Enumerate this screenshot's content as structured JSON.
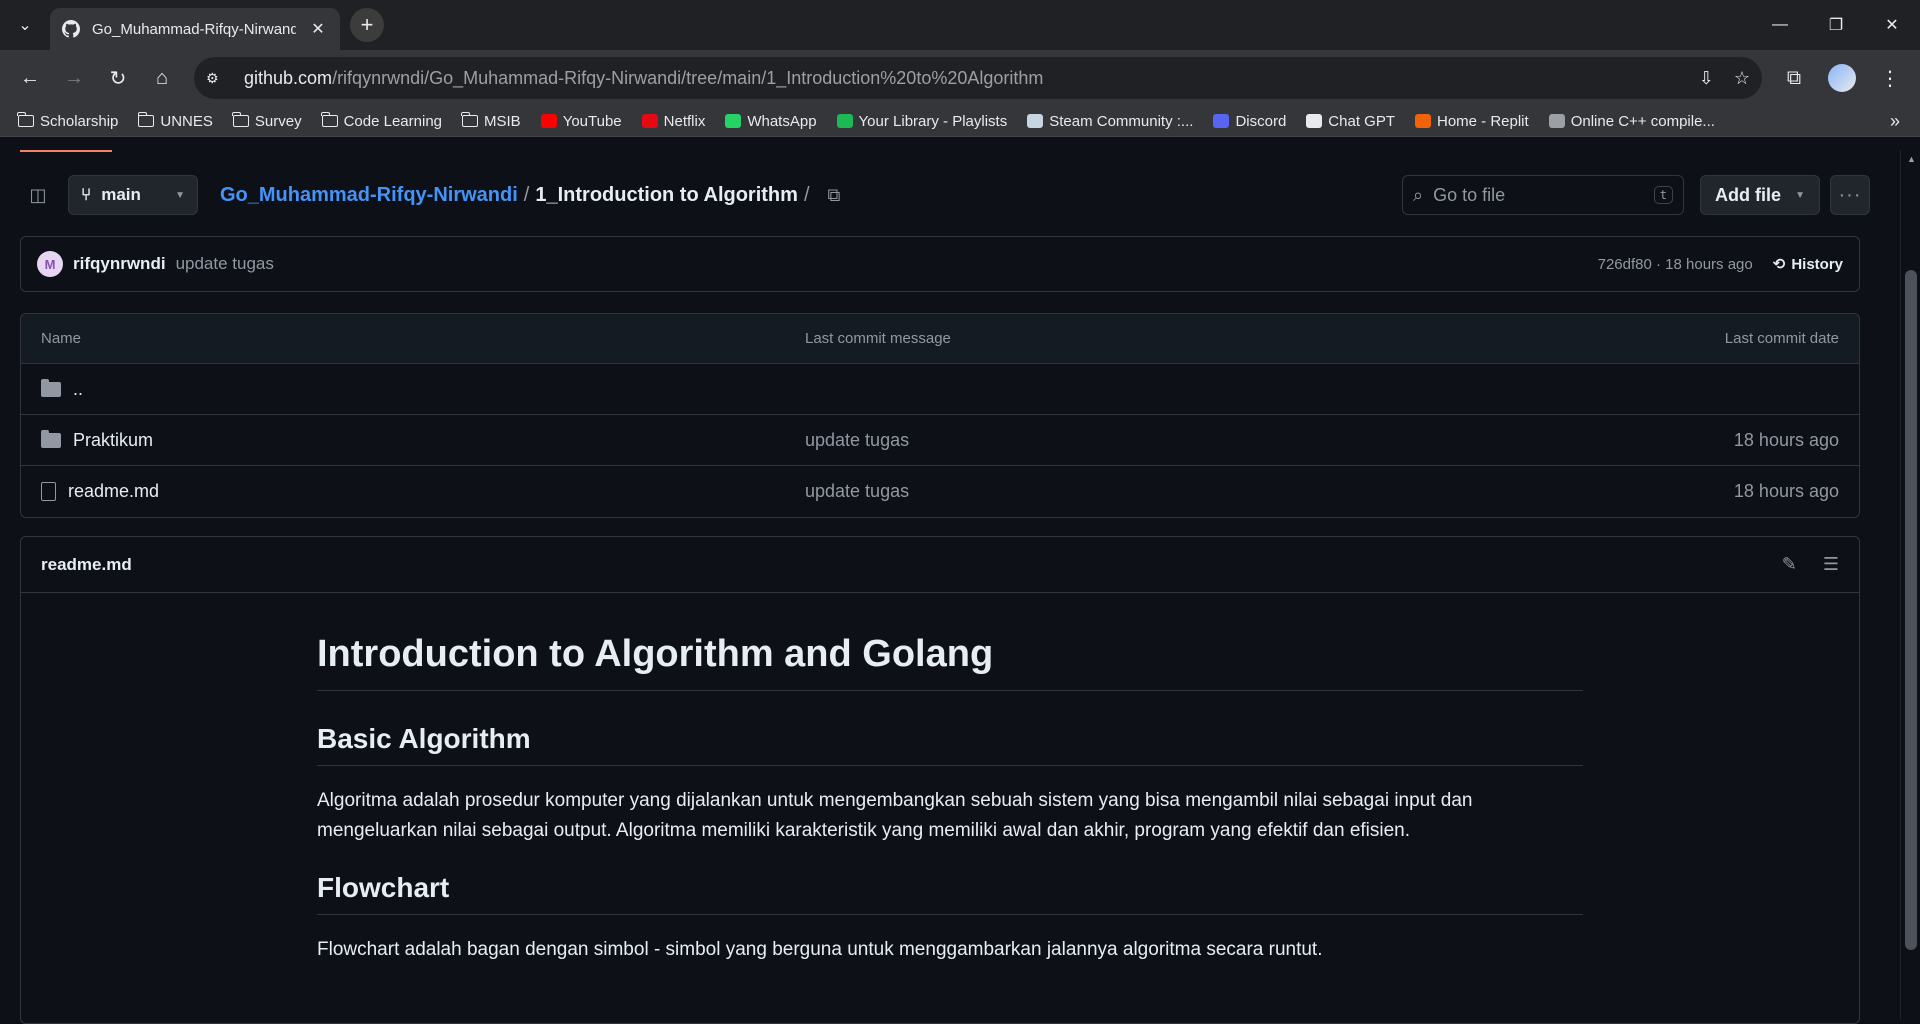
{
  "browser": {
    "tab_title": "Go_Muhammad-Rifqy-Nirwandi",
    "url_host": "github.com",
    "url_path": "/rifqynrwndi/Go_Muhammad-Rifqy-Nirwandi/tree/main/1_Introduction%20to%20Algorithm",
    "bookmarks": [
      {
        "label": "Scholarship",
        "icon": "folder-icon"
      },
      {
        "label": "UNNES",
        "icon": "folder-icon"
      },
      {
        "label": "Survey",
        "icon": "folder-icon"
      },
      {
        "label": "Code Learning",
        "icon": "folder-icon"
      },
      {
        "label": "MSIB",
        "icon": "folder-icon"
      },
      {
        "label": "YouTube",
        "icon": "youtube-icon",
        "color": "#ff0000"
      },
      {
        "label": "Netflix",
        "icon": "netflix-icon",
        "color": "#e50914"
      },
      {
        "label": "WhatsApp",
        "icon": "whatsapp-icon",
        "color": "#25d366"
      },
      {
        "label": "Your Library - Playlists",
        "icon": "spotify-icon",
        "color": "#1db954"
      },
      {
        "label": "Steam Community :...",
        "icon": "steam-icon",
        "color": "#c7d5e0"
      },
      {
        "label": "Discord",
        "icon": "discord-icon",
        "color": "#5865f2"
      },
      {
        "label": "Chat GPT",
        "icon": "chatgpt-icon",
        "color": "#e8eaed"
      },
      {
        "label": "Home - Replit",
        "icon": "replit-icon",
        "color": "#f26207"
      },
      {
        "label": "Online C++ compile...",
        "icon": "ide-icon",
        "color": "#9aa0a6"
      }
    ]
  },
  "repo": {
    "branch": "main",
    "repo_name": "Go_Muhammad-Rifqy-Nirwandi",
    "current_dir": "1_Introduction to Algorithm",
    "go_to_file_placeholder": "Go to file",
    "shortcut_key": "t",
    "add_file_label": "Add file"
  },
  "commit": {
    "avatar_letter": "M",
    "user": "rifqynrwndi",
    "message": "update tugas",
    "hash_time": "726df80 · 18 hours ago",
    "history_label": "History"
  },
  "table": {
    "headers": {
      "name": "Name",
      "message": "Last commit message",
      "date": "Last commit date"
    },
    "rows": [
      {
        "name": "..",
        "type": "dir",
        "message": "",
        "date": ""
      },
      {
        "name": "Praktikum",
        "type": "dir",
        "message": "update tugas",
        "date": "18 hours ago"
      },
      {
        "name": "readme.md",
        "type": "file",
        "message": "update tugas",
        "date": "18 hours ago"
      }
    ]
  },
  "readme": {
    "filename": "readme.md",
    "h1": "Introduction to Algorithm and Golang",
    "h2_basic": "Basic Algorithm",
    "p_basic": "Algoritma adalah prosedur komputer yang dijalankan untuk mengembangkan sebuah sistem yang bisa mengambil nilai sebagai input dan mengeluarkan nilai sebagai output. Algoritma memiliki karakteristik yang memiliki awal dan akhir, program yang efektif dan efisien.",
    "h2_flow": "Flowchart",
    "p_flow": "Flowchart adalah bagan dengan simbol - simbol yang berguna untuk menggambarkan jalannya algoritma secara runtut."
  }
}
